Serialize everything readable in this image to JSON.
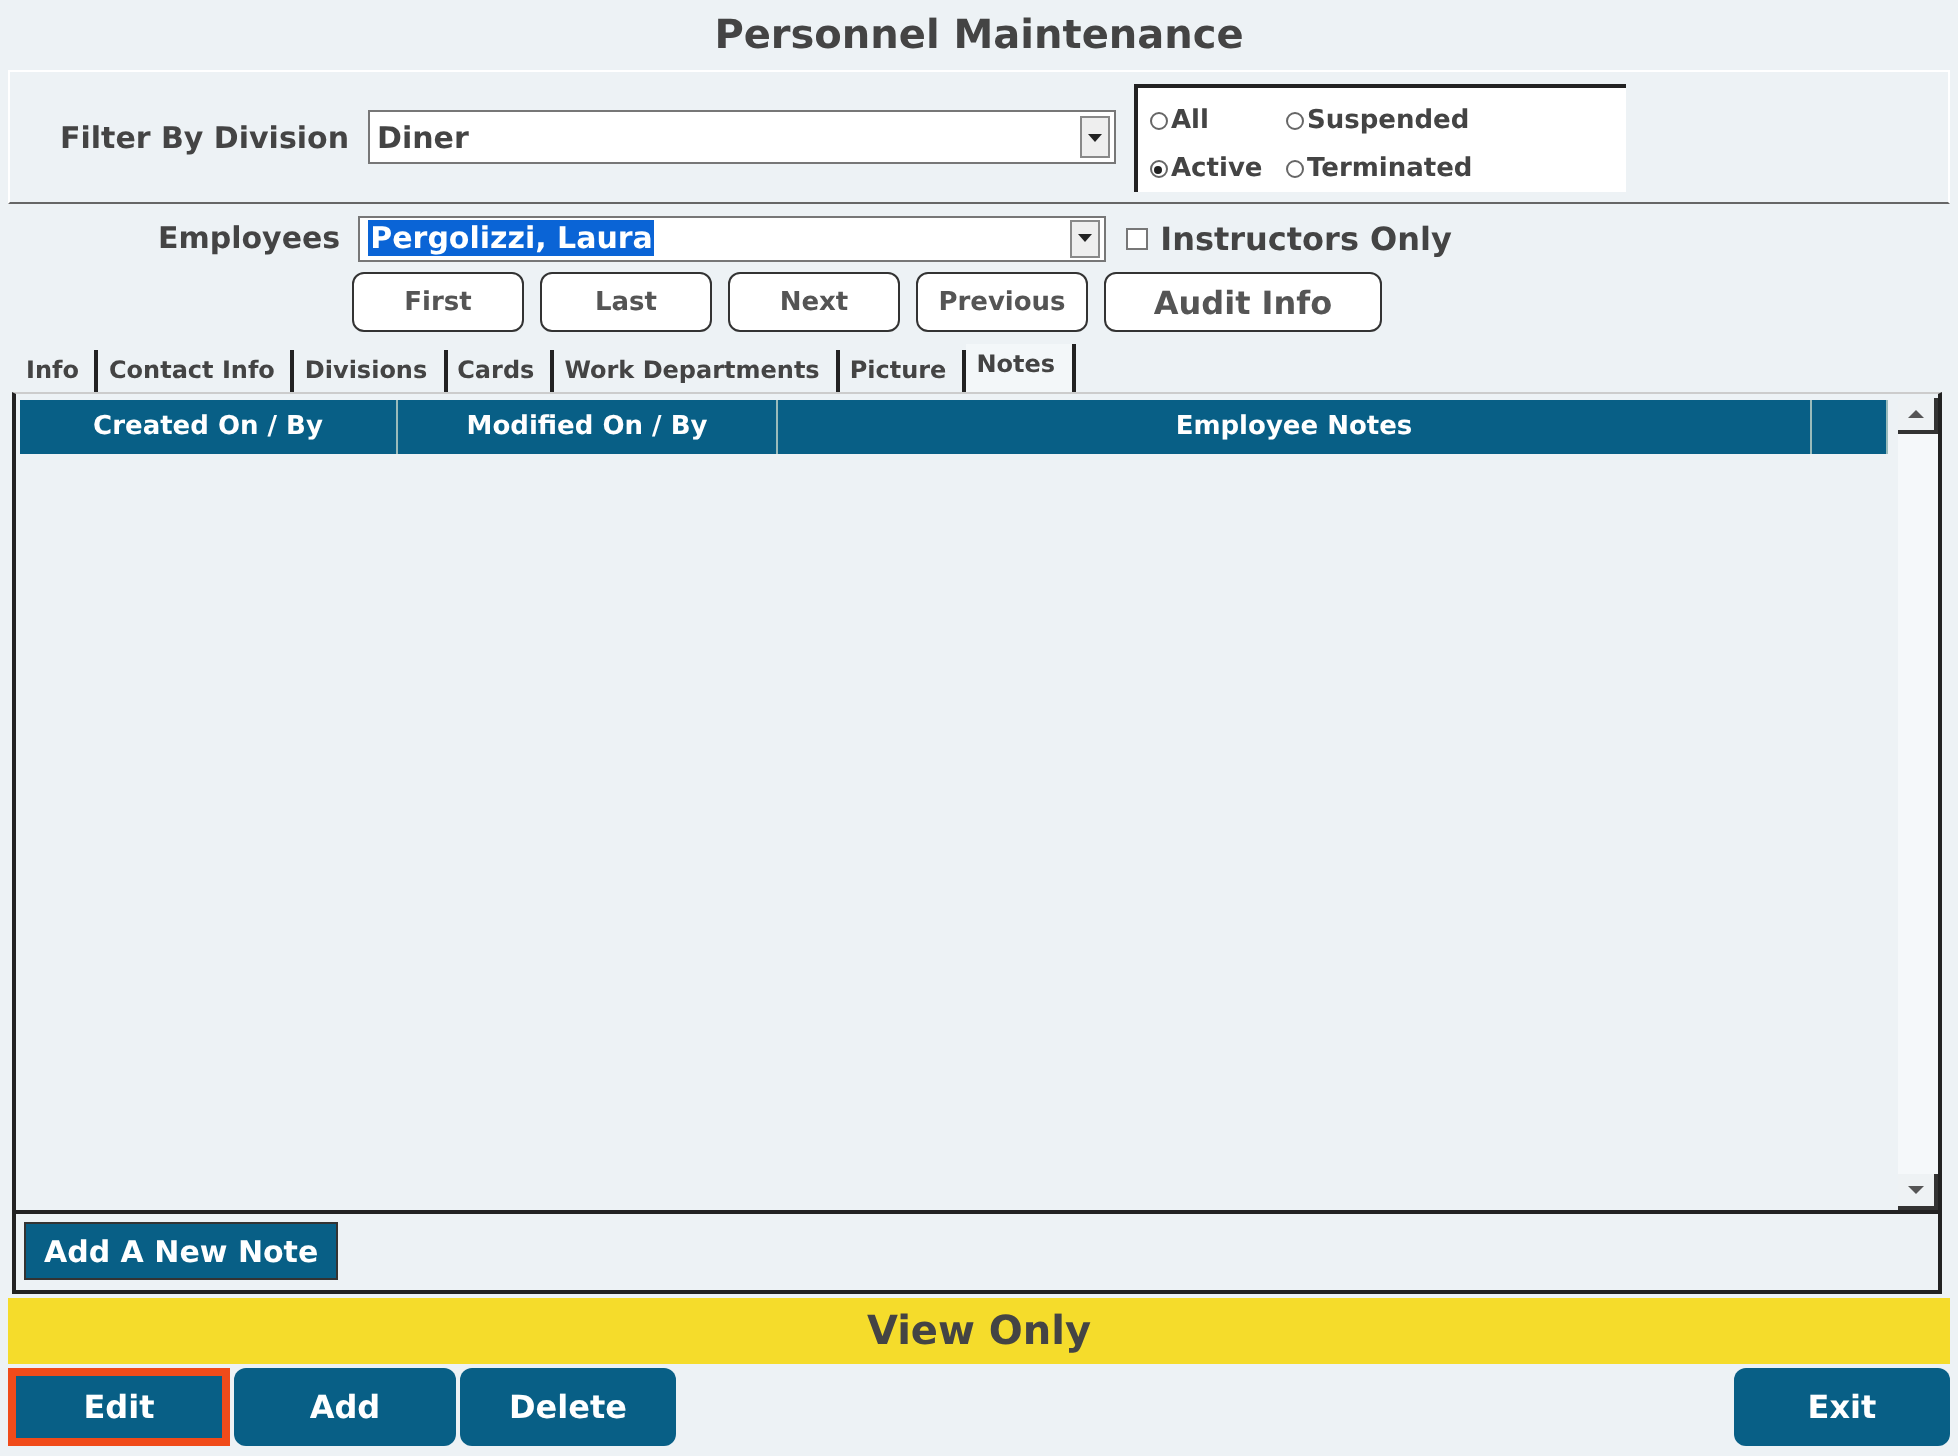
{
  "window": {
    "title": "Personnel Maintenance"
  },
  "filter": {
    "label": "Filter By Division",
    "value": "Diner"
  },
  "status_options": [
    {
      "label": "All",
      "selected": false
    },
    {
      "label": "Suspended",
      "selected": false
    },
    {
      "label": "Active",
      "selected": true
    },
    {
      "label": "Terminated",
      "selected": false
    }
  ],
  "employees": {
    "label": "Employees",
    "value": "Pergolizzi, Laura",
    "text_selected": true
  },
  "instructors_only": {
    "label": "Instructors Only",
    "checked": false
  },
  "nav_buttons": [
    "First",
    "Last",
    "Next",
    "Previous"
  ],
  "audit_button": "Audit Info",
  "tabs": [
    {
      "label": "Info",
      "selected": false
    },
    {
      "label": "Contact Info",
      "selected": false
    },
    {
      "label": "Divisions",
      "selected": false
    },
    {
      "label": "Cards",
      "selected": false
    },
    {
      "label": "Work Departments",
      "selected": false
    },
    {
      "label": "Picture",
      "selected": false
    },
    {
      "label": "Notes",
      "selected": true
    }
  ],
  "table": {
    "columns": [
      "Created On / By",
      "Modified On / By",
      "Employee Notes"
    ]
  },
  "add_note_button": "Add A New Note",
  "status_bar": "View Only",
  "action_buttons": [
    {
      "label": "Edit",
      "focused": true
    },
    {
      "label": "Add",
      "focused": false
    },
    {
      "label": "Delete",
      "focused": false
    }
  ],
  "exit_button": "Exit"
}
